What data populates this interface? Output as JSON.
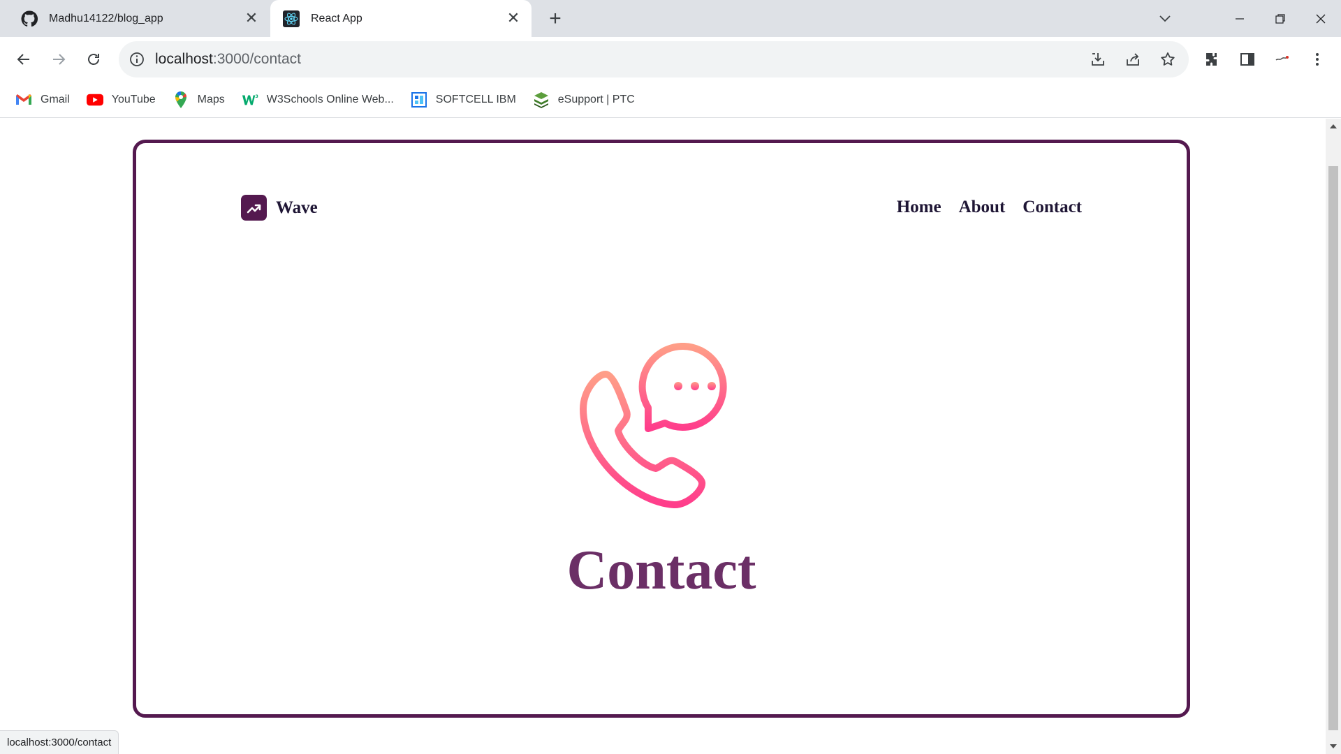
{
  "browser": {
    "tabs": [
      {
        "title": "Madhu14122/blog_app",
        "icon": "github-icon",
        "active": false
      },
      {
        "title": "React App",
        "icon": "react-icon",
        "active": true
      }
    ],
    "url_host": "localhost",
    "url_path": ":3000/contact",
    "bookmarks": [
      {
        "label": "Gmail",
        "icon": "gmail-icon"
      },
      {
        "label": "YouTube",
        "icon": "youtube-icon"
      },
      {
        "label": "Maps",
        "icon": "maps-icon"
      },
      {
        "label": "W3Schools Online Web...",
        "icon": "w3schools-icon"
      },
      {
        "label": "SOFTCELL IBM",
        "icon": "softcell-icon"
      },
      {
        "label": "eSupport | PTC",
        "icon": "ptc-icon"
      }
    ],
    "status_url": "localhost:3000/contact"
  },
  "page": {
    "brand": "Wave",
    "nav": [
      "Home",
      "About",
      "Contact"
    ],
    "hero_title": "Contact",
    "hero_icon": "phone-chat-icon"
  },
  "colors": {
    "card_border": "#54194f",
    "brand_text": "#1f1635",
    "title": "#6b2f66",
    "icon_gradient_top": "#ff9e88",
    "icon_gradient_bottom": "#ff3d8b"
  }
}
